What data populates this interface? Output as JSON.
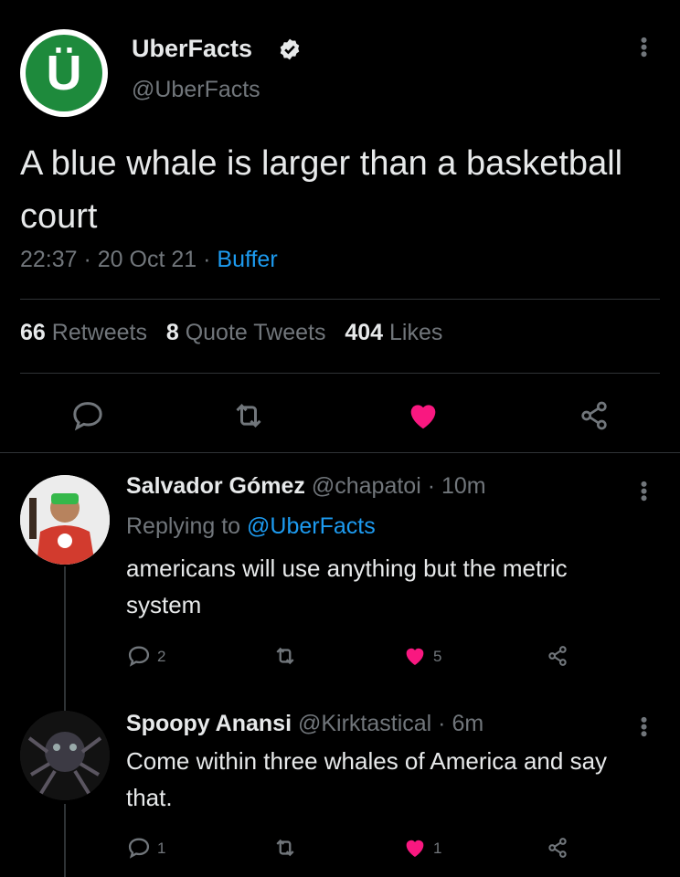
{
  "tweet": {
    "avatar_letter": "Ü",
    "author_name": "UberFacts",
    "author_handle": "@UberFacts",
    "text": "A blue whale is larger than a basketball court",
    "time": "22:37",
    "date": "20 Oct 21",
    "source": "Buffer",
    "retweets_count": "66",
    "retweets_label": "Retweets",
    "quotes_count": "8",
    "quotes_label": "Quote Tweets",
    "likes_count": "404",
    "likes_label": "Likes"
  },
  "replies": [
    {
      "name": "Salvador Gómez",
      "handle": "@chapatoi",
      "time": "10m",
      "replying_prefix": "Replying to",
      "replying_to": "@UberFacts",
      "text": "americans will use anything but the metric system",
      "reply_count": "2",
      "like_count": "5"
    },
    {
      "name": "Spoopy Anansi",
      "handle": "@Kirktastical",
      "time": "6m",
      "text": "Come within three whales of America and say that.",
      "reply_count": "1",
      "like_count": "1"
    }
  ],
  "colors": {
    "background": "#000000",
    "text": "#e7e9ea",
    "muted": "#71767b",
    "link": "#1d9bf0",
    "like": "#f91880",
    "brand": "#1e8a3c"
  },
  "icons": [
    "verified-badge-icon",
    "more-icon",
    "reply-icon",
    "retweet-icon",
    "heart-icon",
    "share-icon"
  ]
}
